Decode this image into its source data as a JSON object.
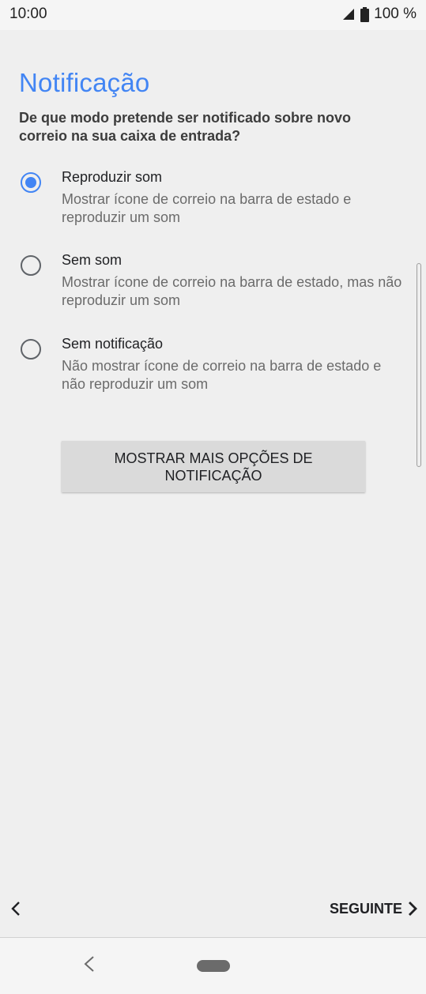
{
  "status_bar": {
    "time": "10:00",
    "battery": "100 %",
    "icons": [
      "signal-icon",
      "battery-icon"
    ]
  },
  "page": {
    "title": "Notificação",
    "subtitle": "De que modo pretende ser notificado sobre novo correio na sua caixa de entrada?"
  },
  "options": [
    {
      "label": "Reproduzir som",
      "description": "Mostrar ícone de correio na barra de estado e reproduzir um som",
      "selected": true
    },
    {
      "label": "Sem som",
      "description": "Mostrar ícone de correio na barra de estado, mas não reproduzir um som",
      "selected": false
    },
    {
      "label": "Sem notificação",
      "description": "Não mostrar ícone de correio na barra de estado e não reproduzir um som",
      "selected": false
    }
  ],
  "more_button": {
    "label": "MOSTRAR MAIS OPÇÕES DE NOTIFICAÇÃO"
  },
  "footer": {
    "next_label": "SEGUINTE"
  },
  "colors": {
    "accent": "#4285f4",
    "background": "#efefef",
    "button": "#dadada"
  }
}
